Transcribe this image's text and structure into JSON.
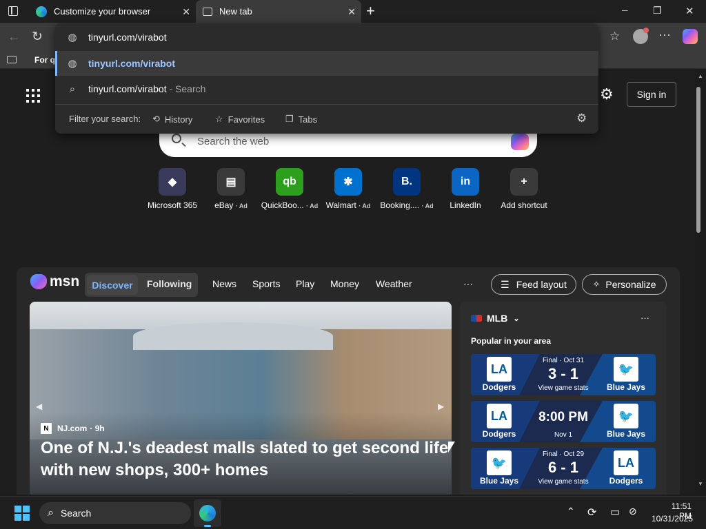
{
  "tabs": [
    {
      "title": "Customize your browser",
      "close": "✕"
    },
    {
      "title": "New tab",
      "close": "✕"
    }
  ],
  "new_tab_glyph": "+",
  "window_controls": {
    "minimize": "─",
    "restore": "❐",
    "close": "✕"
  },
  "address_bar": {
    "value": "tinyurl.com/virabot"
  },
  "favorites_bar": {
    "item": "For q"
  },
  "omnibox": {
    "suggestions": [
      {
        "text": "tinyurl.com/virabot",
        "kind": "url",
        "icon": "globe-icon"
      },
      {
        "text": "tinyurl.com/virabot",
        "suffix": " - Search",
        "kind": "search",
        "icon": "search-icon"
      }
    ],
    "filter_label": "Filter your search:",
    "filters": [
      "History",
      "Favorites",
      "Tabs"
    ]
  },
  "page": {
    "sign_in": "Sign in",
    "search_placeholder": "Search the web",
    "shortcuts": [
      {
        "label": "Microsoft 365",
        "ad": "",
        "color": "#3a3a5a",
        "glyph": "◆"
      },
      {
        "label": "eBay",
        "ad": "· Ad",
        "color": "#3a3a3a",
        "glyph": "▤"
      },
      {
        "label": "QuickBoo...",
        "ad": "· Ad",
        "color": "#2ca01c",
        "glyph": "qb"
      },
      {
        "label": "Walmart",
        "ad": "· Ad",
        "color": "#0071ce",
        "glyph": "✱"
      },
      {
        "label": "Booking....",
        "ad": "· Ad",
        "color": "#003580",
        "glyph": "B."
      },
      {
        "label": "LinkedIn",
        "ad": "",
        "color": "#0a66c2",
        "glyph": "in"
      },
      {
        "label": "Add shortcut",
        "ad": "",
        "color": "#3a3a3a",
        "glyph": "+"
      }
    ]
  },
  "msn": {
    "brand": "msn",
    "tabs": [
      "Discover",
      "Following"
    ],
    "nav": [
      "News",
      "Sports",
      "Play",
      "Money",
      "Weather"
    ],
    "more": "···",
    "feed_layout": "Feed layout",
    "personalize": "Personalize"
  },
  "hero": {
    "source": "NJ.com",
    "age": "· 9h",
    "headline_line1": "One of N.J.'s deadest malls slated to get second life",
    "headline_line2": "with new shops, 300+ homes"
  },
  "mlb": {
    "title": "MLB",
    "subtitle": "Popular in your area",
    "more": "···",
    "games": [
      {
        "status": "Final · Oct 31",
        "score": "3 - 1",
        "link": "View game stats",
        "left_team": "Dodgers",
        "right_team": "Blue Jays",
        "left_logo": "LA",
        "right_logo": "🐦"
      },
      {
        "status": "",
        "score": "8:00 PM",
        "link": "Nov 1",
        "left_team": "Dodgers",
        "right_team": "Blue Jays",
        "left_logo": "LA",
        "right_logo": "🐦"
      },
      {
        "status": "Final · Oct 29",
        "score": "6 - 1",
        "link": "View game stats",
        "left_team": "Blue Jays",
        "right_team": "Dodgers",
        "left_logo": "🐦",
        "right_logo": "LA"
      }
    ]
  },
  "taskbar": {
    "search": "Search",
    "time": "11:51 PM",
    "date": "10/31/2025"
  }
}
